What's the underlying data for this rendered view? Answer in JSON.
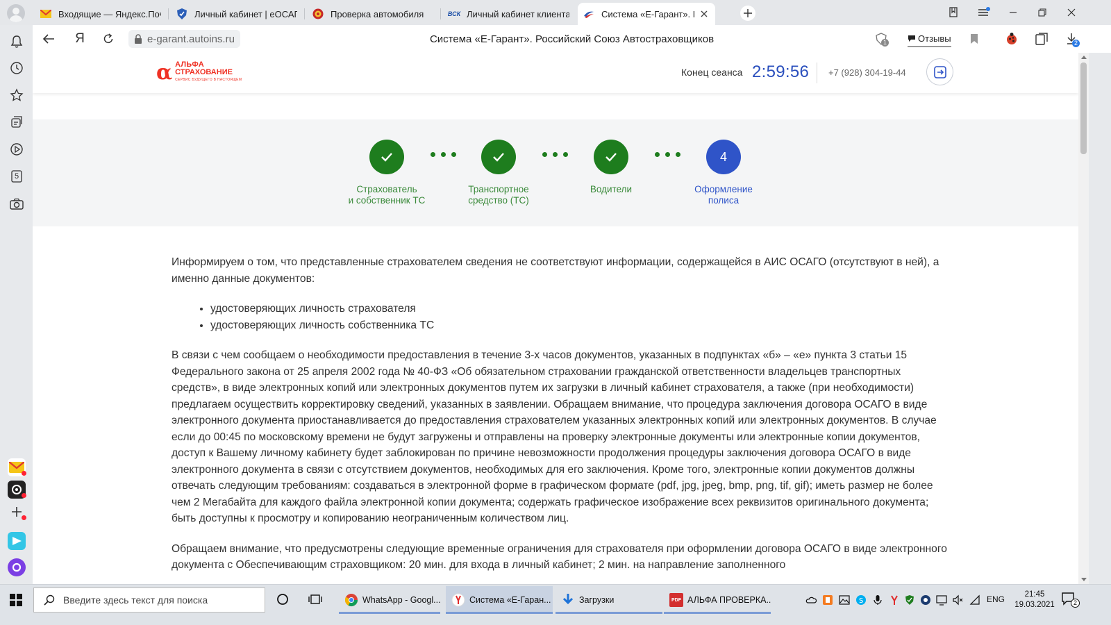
{
  "browser": {
    "tabs": [
      {
        "title": "Входящие — Яндекс.Почта",
        "favicon": "mail-icon",
        "active": false
      },
      {
        "title": "Личный кабинет | еОСАГО",
        "favicon": "shield-icon",
        "active": false
      },
      {
        "title": "Проверка автомобиля",
        "favicon": "emblem-icon",
        "active": false
      },
      {
        "title": "Личный кабинет клиента",
        "favicon": "vsk-icon",
        "favicon_text": "ВСК",
        "active": false
      },
      {
        "title": "Система «Е-Гарант». Российский Союз",
        "favicon": "rsa-icon",
        "active": true
      }
    ],
    "url": "e-garant.autoins.ru",
    "page_title": "Система «Е-Гарант». Российский Союз Автостраховщиков",
    "reviews_label": "Отзывы",
    "tracker_badge": "1",
    "downloads_badge": "2",
    "yandex_letter": "Я",
    "sidebar_counter": "5"
  },
  "site": {
    "logo": {
      "symbol": "α",
      "line1": "АЛЬФА",
      "line2": "СТРАХОВАНИЕ",
      "tagline": "СЕРВИС БУДУЩЕГО В НАСТОЯЩЕМ"
    },
    "session_label": "Конец сеанса",
    "session_timer": "2:59:56",
    "phone": "+7 (928) 304-19-44"
  },
  "stepper": {
    "steps": [
      {
        "label_line1": "Страхователь",
        "label_line2": "и собственник ТС",
        "status": "done"
      },
      {
        "label_line1": "Транспортное",
        "label_line2": "средство (ТС)",
        "status": "done"
      },
      {
        "label_line1": "Водители",
        "label_line2": "",
        "status": "done"
      },
      {
        "label_line1": "Оформление",
        "label_line2": "полиса",
        "status": "current",
        "number": "4"
      }
    ]
  },
  "content": {
    "intro": "Информируем о том, что представленные страхователем сведения не соответствуют информации, содержащейся в АИС ОСАГО (отсутствуют в ней), а именно данные документов:",
    "list": [
      "удостоверяющих личность страхователя",
      "удостоверяющих личность собственника ТС"
    ],
    "paragraph2": "В связи с чем сообщаем о необходимости предоставления в течение 3-х часов документов, указанных в подпунктах «б» – «е» пункта 3 статьи 15 Федерального закона от 25 апреля 2002 года № 40-ФЗ «Об обязательном страховании гражданской ответственности владельцев транспортных средств», в виде электронных копий или электронных документов путем их загрузки в личный кабинет страхователя, а также (при необходимости) предлагаем осуществить корректировку сведений, указанных в заявлении. Обращаем внимание, что процедура заключения договора ОСАГО в виде электронного документа приостанавливается до предоставления страхователем указанных электронных копий или электронных документов. В случае если до 00:45 по московскому времени не будут загружены и отправлены на проверку электронные документы или электронные копии документов, доступ к Вашему личному кабинету будет заблокирован по причине невозможности продолжения процедуры заключения договора ОСАГО в виде электронного документа в связи с отсутствием документов, необходимых для его заключения. Кроме того, электронные копии документов должны отвечать следующим требованиям: создаваться в электронной форме в графическом формате (pdf, jpg, jpeg, bmp, png, tif, gif); иметь размер не более чем 2 Мегабайта для каждого файла электронной копии документа; содержать графическое изображение всех реквизитов оригинального документа; быть доступны к просмотру и копированию неограниченным количеством лиц.",
    "paragraph3": "Обращаем внимание, что предусмотрены следующие временные ограничения для страхователя при оформлении договора ОСАГО в виде электронного документа с Обеспечивающим страховщиком: 20 мин. для входа в личный кабинет; 2 мин. на направление заполненного"
  },
  "taskbar": {
    "search_placeholder": "Введите здесь текст для поиска",
    "apps": [
      {
        "label": "WhatsApp - Googl...",
        "icon": "chrome-icon"
      },
      {
        "label": "Система «Е-Гаран...",
        "icon": "yandex-browser-icon"
      },
      {
        "label": "Загрузки",
        "icon": "downloads-folder-icon"
      },
      {
        "label": "АЛЬФА ПРОВЕРКА...",
        "icon": "pdf-icon",
        "icon_text": "PDF"
      }
    ],
    "lang": "ENG",
    "time": "21:45",
    "date": "19.03.2021",
    "notification_count": "2"
  },
  "colors": {
    "done": "#1e7d1e",
    "current": "#2f54c8",
    "brand_red": "#ef3124",
    "timer": "#2a4fbd"
  }
}
